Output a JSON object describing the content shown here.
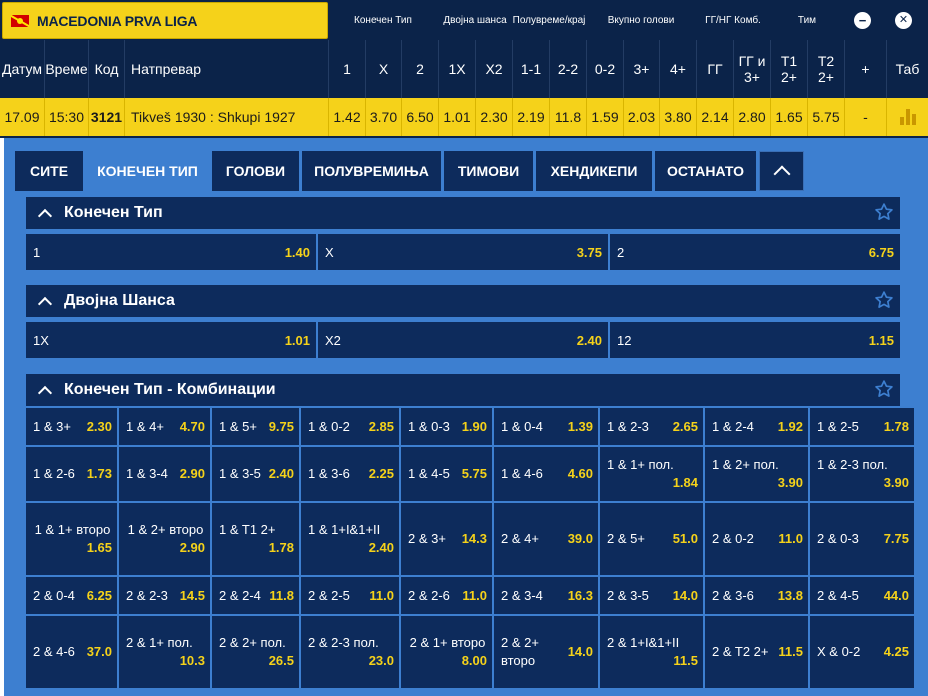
{
  "league": {
    "name": "MACEDONIA PRVA LIGA",
    "flag_icon": "macedonia-flag-icon"
  },
  "groups": [
    "Конечен Тип",
    "Двојна шанса",
    "Полувреме/крај",
    "Вкупно голови",
    "ГГ/НГ Комб.",
    "Тим"
  ],
  "header_icons": {
    "minus": "−",
    "close": "✕"
  },
  "columns": {
    "date": "Датум",
    "time": "Време",
    "code": "Код",
    "match": "Натпревар",
    "c1": "1",
    "cx": "X",
    "c2": "2",
    "c1x": "1X",
    "cx2": "X2",
    "c11": "1-1",
    "c22": "2-2",
    "c02": "0-2",
    "c3p": "3+",
    "c4p": "4+",
    "cgg": "ГГ",
    "cgg3": "ГГ и 3+",
    "ct1": "Т1 2+",
    "ct2": "Т2 2+",
    "plus": "+",
    "tab": "Таб"
  },
  "match": {
    "date": "17.09",
    "time": "15:30",
    "code": "3121",
    "name": "Tikveš 1930 : Shkupi 1927",
    "o1": "1.42",
    "ox": "3.70",
    "o2": "6.50",
    "o1x": "1.01",
    "ox2": "2.30",
    "o11": "2.19",
    "o22": "11.8",
    "o02": "1.59",
    "o3p": "2.03",
    "o4p": "3.80",
    "ogg": "2.14",
    "ogg3": "2.80",
    "ot1": "1.65",
    "ot2": "5.75",
    "more": "-"
  },
  "tabs": [
    "СИТЕ",
    "КОНЕЧЕН ТИП",
    "ГОЛОВИ",
    "ПОЛУВРЕМИЊА",
    "ТИМОВИ",
    "ХЕНДИКЕПИ",
    "ОСТАНАТО"
  ],
  "sections": {
    "final": {
      "title": "Конечен Тип",
      "items": [
        {
          "label": "1",
          "odd": "1.40"
        },
        {
          "label": "X",
          "odd": "3.75"
        },
        {
          "label": "2",
          "odd": "6.75"
        }
      ]
    },
    "double": {
      "title": "Двојна Шанса",
      "items": [
        {
          "label": "1X",
          "odd": "1.01"
        },
        {
          "label": "X2",
          "odd": "2.40"
        },
        {
          "label": "12",
          "odd": "1.15"
        }
      ]
    },
    "combo": {
      "title": "Конечен Тип - Комбинации",
      "rows": [
        [
          {
            "label": "1 & 3+",
            "odd": "2.30"
          },
          {
            "label": "1 & 4+",
            "odd": "4.70"
          },
          {
            "label": "1 & 5+",
            "odd": "9.75"
          },
          {
            "label": "1 & 0-2",
            "odd": "2.85"
          },
          {
            "label": "1 & 0-3",
            "odd": "1.90"
          },
          {
            "label": "1 & 0-4",
            "odd": "1.39"
          },
          {
            "label": "1 & 2-3",
            "odd": "2.65"
          },
          {
            "label": "1 & 2-4",
            "odd": "1.92"
          },
          {
            "label": "1 & 2-5",
            "odd": "1.78"
          }
        ],
        [
          {
            "label": "1 & 2-6",
            "odd": "1.73"
          },
          {
            "label": "1 & 3-4",
            "odd": "2.90"
          },
          {
            "label": "1 & 3-5",
            "odd": "2.40"
          },
          {
            "label": "1 & 3-6",
            "odd": "2.25"
          },
          {
            "label": "1 & 4-5",
            "odd": "5.75"
          },
          {
            "label": "1 & 4-6",
            "odd": "4.60"
          },
          {
            "label": "1 & 1+ пол.",
            "odd": "1.84"
          },
          {
            "label": "1 & 2+ пол.",
            "odd": "3.90"
          },
          {
            "label": "1 & 2-3 пол.",
            "odd": "3.90"
          }
        ],
        [
          {
            "label": "1 & 1+ второ",
            "odd": "1.65"
          },
          {
            "label": "1 & 2+ второ",
            "odd": "2.90"
          },
          {
            "label": "1 & T1 2+",
            "odd": "1.78"
          },
          {
            "label": "1 & 1+I&1+II",
            "odd": "2.40"
          },
          {
            "label": "2 & 3+",
            "odd": "14.3"
          },
          {
            "label": "2 & 4+",
            "odd": "39.0"
          },
          {
            "label": "2 & 5+",
            "odd": "51.0"
          },
          {
            "label": "2 & 0-2",
            "odd": "11.0"
          },
          {
            "label": "2 & 0-3",
            "odd": "7.75"
          }
        ],
        [
          {
            "label": "2 & 0-4",
            "odd": "6.25"
          },
          {
            "label": "2 & 2-3",
            "odd": "14.5"
          },
          {
            "label": "2 & 2-4",
            "odd": "11.8"
          },
          {
            "label": "2 & 2-5",
            "odd": "11.0"
          },
          {
            "label": "2 & 2-6",
            "odd": "11.0"
          },
          {
            "label": "2 & 3-4",
            "odd": "16.3"
          },
          {
            "label": "2 & 3-5",
            "odd": "14.0"
          },
          {
            "label": "2 & 3-6",
            "odd": "13.8"
          },
          {
            "label": "2 & 4-5",
            "odd": "44.0"
          }
        ],
        [
          {
            "label": "2 & 4-6",
            "odd": "37.0"
          },
          {
            "label": "2 & 1+ пол.",
            "odd": "10.3"
          },
          {
            "label": "2 & 2+ пол.",
            "odd": "26.5"
          },
          {
            "label": "2 & 2-3 пол.",
            "odd": "23.0"
          },
          {
            "label": "2 & 1+ второ",
            "odd": "8.00"
          },
          {
            "label": "2 & 2+ второ",
            "odd": "14.0"
          },
          {
            "label": "2 & 1+I&1+II",
            "odd": "11.5"
          },
          {
            "label": "2 & T2 2+",
            "odd": "11.5"
          },
          {
            "label": "X & 0-2",
            "odd": "4.25"
          }
        ]
      ]
    }
  },
  "colors": {
    "navy": "#0b2349",
    "yellow": "#f5d21a",
    "panel": "#3d7fd0"
  }
}
